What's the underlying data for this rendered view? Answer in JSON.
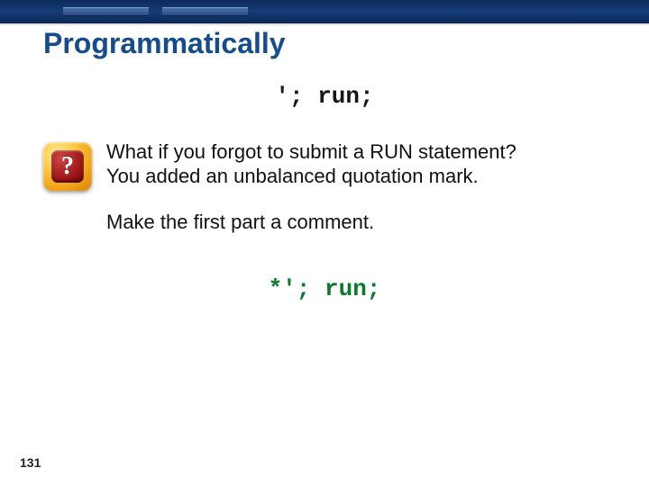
{
  "title": "Programmatically",
  "code_line_1": "'; run;",
  "question_icon_glyph": "?",
  "paragraph_1_line_1": "What if you forgot to submit a RUN statement?",
  "paragraph_1_line_2": "You added an unbalanced quotation mark.",
  "paragraph_2": "Make the first part a comment.",
  "code_line_2": "*'; run;",
  "page_number": "131"
}
